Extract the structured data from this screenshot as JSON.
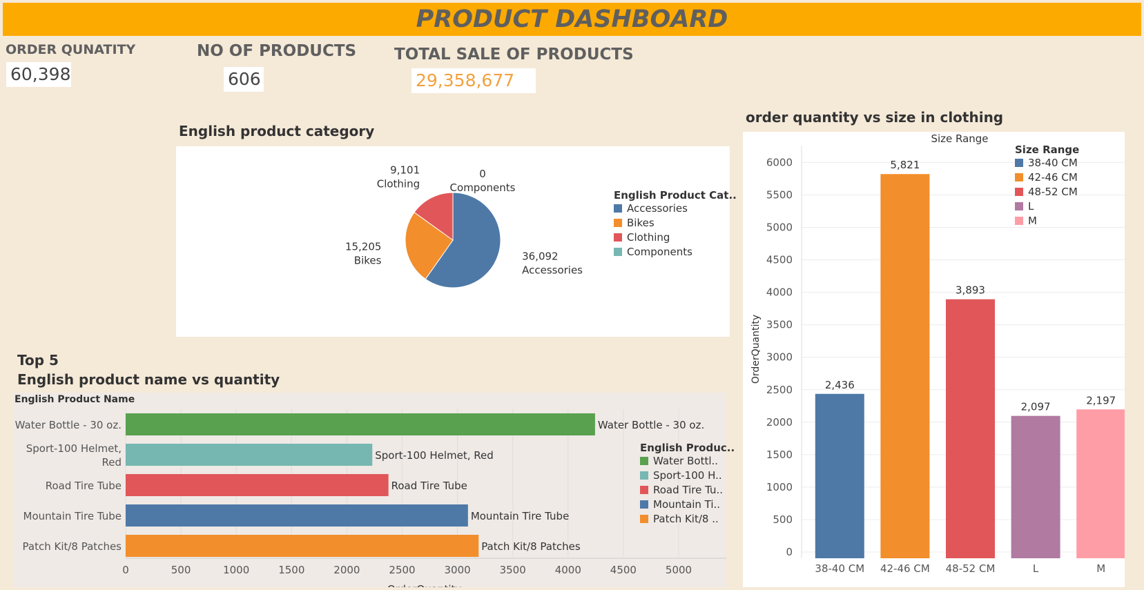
{
  "header": {
    "title": "PRODUCT DASHBOARD"
  },
  "kpis": {
    "order_quantity": {
      "label": "ORDER QUNATITY",
      "value": "60,398"
    },
    "products": {
      "label": "NO OF PRODUCTS",
      "value": "606"
    },
    "total_sale": {
      "label": "TOTAL SALE OF PRODUCTS",
      "value": "29,358,677"
    }
  },
  "colors": {
    "banner": "#fdaa00",
    "background": "#f5e9d8",
    "sale_value": "#f2a13e",
    "blue": "#4e79a7",
    "orange": "#f28e2b",
    "red": "#e15759",
    "teal": "#76b7b2",
    "green": "#59a14f",
    "purple": "#b07aa1",
    "pink": "#ff9da7"
  },
  "chart_data": [
    {
      "type": "pie",
      "title": "English product category",
      "legend_title": "English Product Cat..",
      "legend_position": "right",
      "slices": [
        {
          "name": "Accessories",
          "value": 36092,
          "label": "36,092",
          "color": "#4e79a7"
        },
        {
          "name": "Bikes",
          "value": 15205,
          "label": "15,205",
          "color": "#f28e2b"
        },
        {
          "name": "Clothing",
          "value": 9101,
          "label": "9,101",
          "color": "#e15759"
        },
        {
          "name": "Components",
          "value": 0,
          "label": "0",
          "color": "#76b7b2"
        }
      ]
    },
    {
      "type": "bar",
      "orientation": "horizontal",
      "title_line1": "Top 5",
      "title_line2": "English product name vs quantity",
      "ylabel": "English Product Name",
      "xlabel": "OrderQuantity",
      "xlim": [
        0,
        5400
      ],
      "xticks": [
        0,
        500,
        1000,
        1500,
        2000,
        2500,
        3000,
        3500,
        4000,
        4500,
        5000
      ],
      "grid": true,
      "legend_title": "English Produc..",
      "legend_position": "right",
      "bars": [
        {
          "name": "Water Bottle - 30 oz.",
          "axis_lines": [
            "Water Bottle - 30 oz."
          ],
          "legend": "Water Bottl..",
          "value": 4244,
          "color": "#59a14f"
        },
        {
          "name": "Sport-100 Helmet, Red",
          "axis_lines": [
            "Sport-100 Helmet,",
            "Red"
          ],
          "legend": "Sport-100 H..",
          "value": 2230,
          "color": "#76b7b2"
        },
        {
          "name": "Road Tire Tube",
          "axis_lines": [
            "Road Tire Tube"
          ],
          "legend": "Road Tire Tu..",
          "value": 2376,
          "color": "#e15759"
        },
        {
          "name": "Mountain Tire Tube",
          "axis_lines": [
            "Mountain Tire Tube"
          ],
          "legend": "Mountain Ti..",
          "value": 3095,
          "color": "#4e79a7"
        },
        {
          "name": "Patch Kit/8 Patches",
          "axis_lines": [
            "Patch Kit/8 Patches"
          ],
          "legend": "Patch Kit/8 ..",
          "value": 3191,
          "color": "#f28e2b"
        }
      ]
    },
    {
      "type": "bar",
      "title": "order quantity vs size in clothing",
      "column_header": "Size Range",
      "ylabel": "OrderQuantity",
      "ylim": [
        0,
        6300
      ],
      "yticks": [
        0,
        500,
        1000,
        1500,
        2000,
        2500,
        3000,
        3500,
        4000,
        4500,
        5000,
        5500,
        6000
      ],
      "grid": true,
      "legend_title": "Size Range",
      "legend_position": "top-right",
      "categories": [
        "38-40 CM",
        "42-46 CM",
        "48-52 CM",
        "L",
        "M"
      ],
      "values": [
        2436,
        5821,
        3893,
        2097,
        2197
      ],
      "labels": [
        "2,436",
        "5,821",
        "3,893",
        "2,097",
        "2,197"
      ],
      "colors": [
        "#4e79a7",
        "#f28e2b",
        "#e15759",
        "#b07aa1",
        "#ff9da7"
      ]
    }
  ]
}
